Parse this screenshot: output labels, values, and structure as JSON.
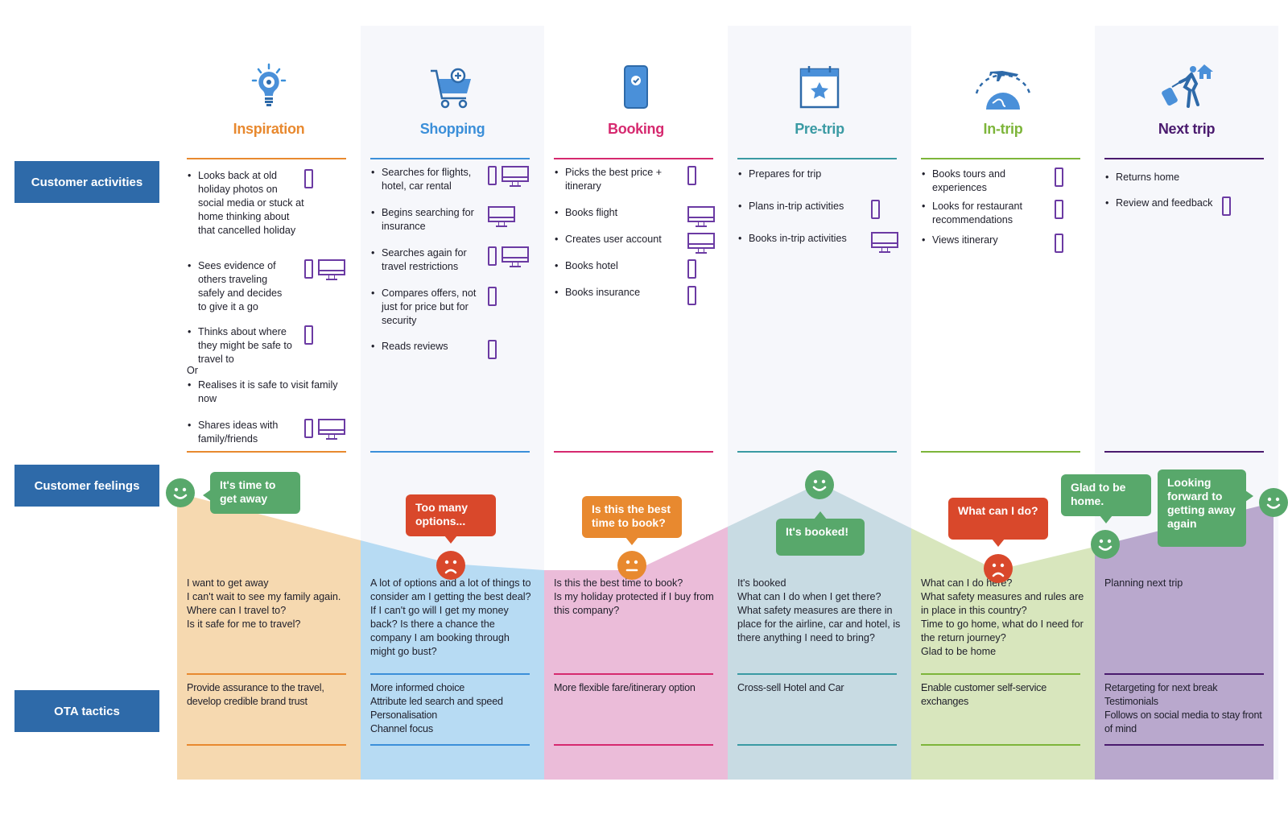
{
  "row_labels": {
    "activities": "Customer activities",
    "feelings": "Customer feelings",
    "tactics": "OTA tactics"
  },
  "colors": {
    "label_bg": "#2e6aa9",
    "device_stroke": "#6b3aa3",
    "happy": "#58a86b",
    "sad": "#d9482b",
    "neutral": "#e8892f"
  },
  "stages": [
    {
      "key": "inspiration",
      "title": "Inspiration",
      "icon": "lightbulb-gear-icon",
      "color": "#e8892f",
      "fill": "#f6d9b0",
      "activities": [
        {
          "text": "Looks back at old holiday photos on social media or stuck at home thinking about that cancelled holiday",
          "devices": [
            "phone"
          ]
        },
        {
          "text": "Sees evidence of others traveling safely and decides to give it a go",
          "devices": [
            "phone",
            "desktop"
          ]
        },
        {
          "text": "Thinks about where they might be safe to travel to",
          "devices": [
            "phone"
          ]
        },
        {
          "text": "Or",
          "devices": [],
          "plain": true
        },
        {
          "text": "Realises it is safe to visit family now",
          "devices": []
        },
        {
          "text": "Shares ideas with family/friends",
          "devices": [
            "phone",
            "desktop"
          ]
        }
      ],
      "feeling": {
        "mood": "happy",
        "bubble": "It's time to get away"
      },
      "feeling_text": "I want to get away\nI can't wait to see my family again.\nWhere can I travel to?\nIs it safe for me to travel?",
      "tactics": "Provide assurance to the travel, develop credible brand trust"
    },
    {
      "key": "shopping",
      "title": "Shopping",
      "icon": "shopping-cart-icon",
      "color": "#3b8fd9",
      "fill": "#b7dbf3",
      "activities": [
        {
          "text": "Searches for flights, hotel, car rental",
          "devices": [
            "phone",
            "desktop"
          ]
        },
        {
          "text": "Begins searching for insurance",
          "devices": [
            "desktop"
          ]
        },
        {
          "text": "Searches again for travel restrictions",
          "devices": [
            "phone",
            "desktop"
          ]
        },
        {
          "text": "Compares offers, not just for price but for security",
          "devices": [
            "phone"
          ]
        },
        {
          "text": "Reads reviews",
          "devices": [
            "phone"
          ]
        }
      ],
      "feeling": {
        "mood": "sad",
        "bubble": "Too many options..."
      },
      "feeling_text": "A lot of options and a lot of things to consider am I getting the best deal? If I can't go will I get my money back? Is there a chance the company I am booking through might go bust?",
      "tactics": "More informed choice\nAttribute led search and speed\nPersonalisation\nChannel focus"
    },
    {
      "key": "booking",
      "title": "Booking",
      "icon": "phone-check-icon",
      "color": "#d6296f",
      "fill": "#ebbcd9",
      "activities": [
        {
          "text": "Picks the best price + itinerary",
          "devices": [
            "phone"
          ]
        },
        {
          "text": "Books flight",
          "devices": [
            "desktop"
          ]
        },
        {
          "text": "Creates user account",
          "devices": [
            "desktop"
          ]
        },
        {
          "text": "Books hotel",
          "devices": [
            "phone"
          ]
        },
        {
          "text": "Books insurance",
          "devices": [
            "phone"
          ]
        }
      ],
      "feeling": {
        "mood": "neutral",
        "bubble": "Is this the best time to book?"
      },
      "feeling_text": "Is this the best time to book?\nIs my holiday protected if I buy from this company?",
      "tactics": "More flexible fare/itinerary option"
    },
    {
      "key": "pre-trip",
      "title": "Pre-trip",
      "icon": "calendar-star-icon",
      "color": "#3a9aa3",
      "fill": "#c8dbe3",
      "activities": [
        {
          "text": "Prepares for trip",
          "devices": []
        },
        {
          "text": "Plans in-trip activities",
          "devices": [
            "phone"
          ]
        },
        {
          "text": "Books in-trip activities",
          "devices": [
            "desktop"
          ]
        }
      ],
      "feeling": {
        "mood": "happy",
        "bubble": "It's booked!"
      },
      "feeling_text": "It's booked\nWhat can I do when I get there? What safety measures are there in place for the airline, car and hotel, is there anything I need to bring?",
      "tactics": "Cross-sell Hotel and Car"
    },
    {
      "key": "in-trip",
      "title": "In-trip",
      "icon": "plane-globe-icon",
      "color": "#7db53a",
      "fill": "#d8e6bd",
      "activities": [
        {
          "text": "Books tours and experiences",
          "devices": [
            "phone"
          ]
        },
        {
          "text": "Looks for restaurant recommendations",
          "devices": [
            "phone"
          ]
        },
        {
          "text": "Views itinerary",
          "devices": [
            "phone"
          ]
        }
      ],
      "feeling": {
        "mood": "sad",
        "bubble": "What can I do?"
      },
      "feeling_text": "What can I do here?\nWhat safety measures and rules are in place in this country?\nTime to go home, what do I need for the return journey?\nGlad to be home",
      "tactics": "Enable customer self-service exchanges"
    },
    {
      "key": "next-trip",
      "title": "Next trip",
      "icon": "traveler-home-icon",
      "color": "#4a1a6e",
      "fill": "#b9a8cd",
      "activities": [
        {
          "text": "Returns home",
          "devices": []
        },
        {
          "text": "Review and feedback",
          "devices": [
            "phone"
          ]
        }
      ],
      "feeling": {
        "mood": "happy",
        "bubble": "Glad to be home.",
        "bubble2": "Looking forward to getting away again"
      },
      "feeling_text": "Planning next trip",
      "tactics": "Retargeting for next break\nTestimonials\nFollows on social media to stay front of mind"
    }
  ]
}
